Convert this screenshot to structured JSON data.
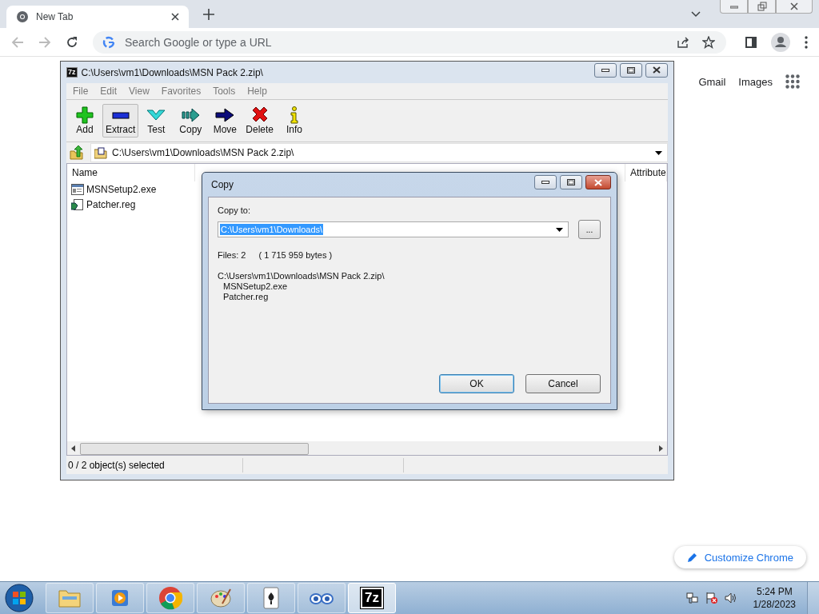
{
  "browser": {
    "tab": {
      "title": "New Tab"
    },
    "omnibox": {
      "placeholder": "Search Google or type a URL"
    },
    "links": [
      "Gmail",
      "Images"
    ],
    "customize_button": "Customize Chrome"
  },
  "archive_window": {
    "icon_text": "7z",
    "title": "C:\\Users\\vm1\\Downloads\\MSN Pack 2.zip\\",
    "menu": [
      "File",
      "Edit",
      "View",
      "Favorites",
      "Tools",
      "Help"
    ],
    "toolbar": [
      {
        "kind": "add",
        "label": "Add",
        "hovered": false
      },
      {
        "kind": "extract",
        "label": "Extract",
        "hovered": true
      },
      {
        "kind": "test",
        "label": "Test",
        "hovered": false
      },
      {
        "kind": "copy",
        "label": "Copy",
        "hovered": false
      },
      {
        "kind": "move",
        "label": "Move",
        "hovered": false
      },
      {
        "kind": "delete",
        "label": "Delete",
        "hovered": false
      },
      {
        "kind": "info",
        "label": "Info",
        "hovered": false
      }
    ],
    "path": "C:\\Users\\vm1\\Downloads\\MSN Pack 2.zip\\",
    "columns": [
      "Name",
      "Attribute"
    ],
    "files": [
      {
        "kind": "exe",
        "name": "MSNSetup2.exe"
      },
      {
        "kind": "reg",
        "name": "Patcher.reg"
      }
    ],
    "status": "0 / 2 object(s) selected"
  },
  "dialog": {
    "title": "Copy",
    "field_label": "Copy to:",
    "destination": {
      "value": "C:\\Users\\vm1\\Downloads\\",
      "selected": true
    },
    "browse_button": "...",
    "file_count": "Files: 2",
    "byte_count": "( 1 715 959 bytes )",
    "source": "C:\\Users\\vm1\\Downloads\\MSN Pack 2.zip\\",
    "items": [
      "MSNSetup2.exe",
      "Patcher.reg"
    ],
    "buttons": [
      {
        "label": "OK",
        "focused": true
      },
      {
        "label": "Cancel",
        "focused": false
      }
    ]
  },
  "taskbar": {
    "apps": [
      {
        "kind": "explorer",
        "selected": false
      },
      {
        "kind": "media",
        "selected": false
      },
      {
        "kind": "browser",
        "selected": false
      },
      {
        "kind": "paint",
        "selected": false
      },
      {
        "kind": "cards",
        "selected": false
      },
      {
        "kind": "eyes",
        "selected": false
      },
      {
        "kind": "archiver",
        "label": "7z",
        "selected": true
      }
    ],
    "time": "5:24 PM",
    "date": "1/28/2023"
  }
}
